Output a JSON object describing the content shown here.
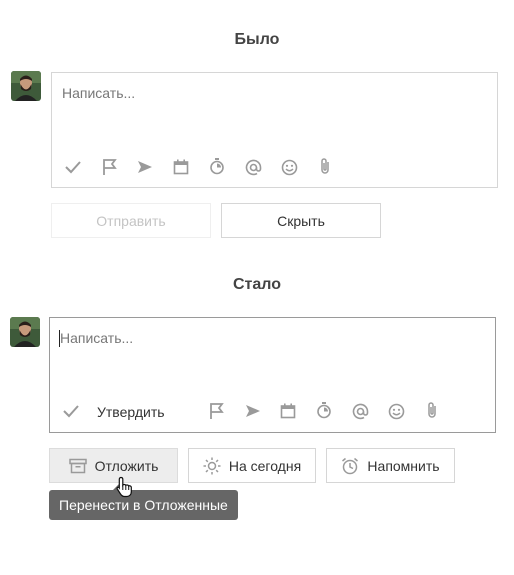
{
  "before": {
    "title": "Было",
    "composer": {
      "placeholder": "Написать..."
    },
    "toolbar_icons": [
      "check-icon",
      "flag-icon",
      "send-icon",
      "calendar-icon",
      "timer-icon",
      "at-icon",
      "smiley-icon",
      "paperclip-icon"
    ],
    "buttons": {
      "send": "Отправить",
      "hide": "Скрыть"
    }
  },
  "after": {
    "title": "Стало",
    "composer": {
      "placeholder": "Написать..."
    },
    "approve_label": "Утвердить",
    "toolbar_icons": [
      "check-icon",
      "flag-icon",
      "send-icon",
      "calendar-icon",
      "timer-icon",
      "at-icon",
      "smiley-icon",
      "paperclip-icon"
    ],
    "buttons": {
      "postpone": "Отложить",
      "today": "На сегодня",
      "remind": "Напомнить"
    },
    "tooltip": "Перенести в Отложенные"
  },
  "colors": {
    "icon": "#9a9a9a",
    "tooltip_bg": "#666666",
    "border": "#d6d6d6"
  }
}
